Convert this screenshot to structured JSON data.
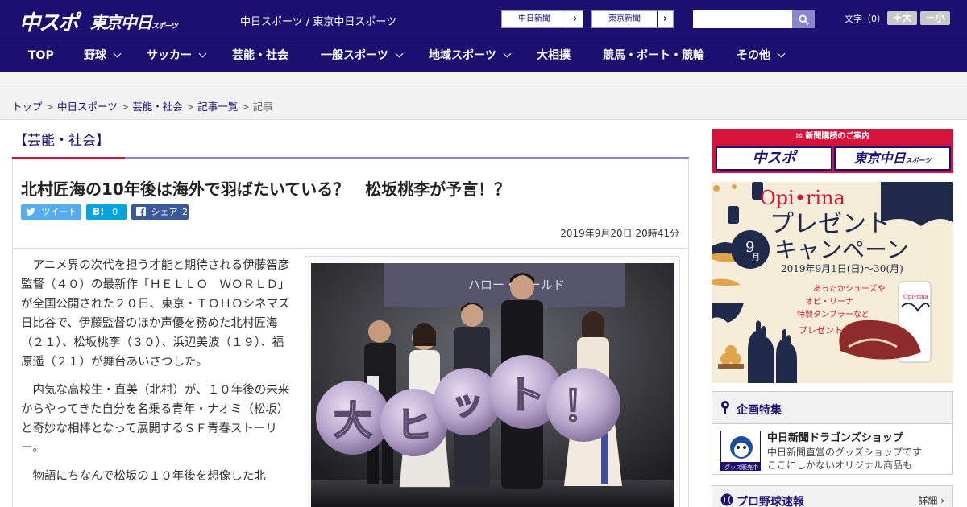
{
  "header": {
    "logo_chuspo": "中スポ",
    "logo_tokyo": "東京中日",
    "logo_tokyo_sub": "スポーツ",
    "site_title": "中日スポーツ / 東京中日スポーツ",
    "btn_chunichi": "中日新聞",
    "btn_tokyo": "東京新聞",
    "arrow": "›",
    "font_size_label": "文字（0）",
    "font_up": "＋大",
    "font_down": "－小"
  },
  "nav": {
    "items": [
      {
        "label": "TOP",
        "has_menu": false
      },
      {
        "label": "野球",
        "has_menu": true
      },
      {
        "label": "サッカー",
        "has_menu": true
      },
      {
        "label": "芸能・社会",
        "has_menu": false
      },
      {
        "label": "一般スポーツ",
        "has_menu": true
      },
      {
        "label": "地域スポーツ",
        "has_menu": true
      },
      {
        "label": "大相撲",
        "has_menu": false
      },
      {
        "label": "競馬・ボート・競輪",
        "has_menu": false
      },
      {
        "label": "その他",
        "has_menu": true
      }
    ]
  },
  "breadcrumb": {
    "items": [
      "トップ",
      "中日スポーツ",
      "芸能・社会",
      "記事一覧"
    ],
    "current": "記事",
    "separator": ">"
  },
  "article": {
    "category": "【芸能・社会】",
    "headline": "北村匠海の10年後は海外で羽ばたいている？　松坂桃李が予言！？",
    "share": {
      "tweet": "ツイート",
      "hatena_logo": "B!",
      "hatena_count": "0",
      "facebook": "シェア",
      "facebook_count": "2"
    },
    "date": "2019年9月20日 20時41分",
    "paragraphs": [
      "アニメ界の次代を担う才能と期待される伊藤智彦監督（４０）の最新作「ＨＥＬＬＯ　ＷＯＲＬＤ」が全国公開された２０日、東京・ＴＯＨＯシネマズ日比谷で、伊藤監督のほか声優を務めた北村匠海（２１）、松坂桃李（３０）、浜辺美波（１９）、福原遥（２１）が舞台あいさつした。",
      "内気な高校生・直美（北村）が、１０年後の未来からやってきた自分を名乗る青年・ナオミ（松坂）と奇妙な相棒となって展開するＳＦ青春ストーリー。",
      "物語にちなんで松坂の１０年後を想像した北"
    ],
    "photo_text": {
      "screen_text": "ハロー・ワールド",
      "banner_text": [
        "大",
        "ヒ",
        "ッ",
        "ト",
        "！"
      ]
    }
  },
  "sidebar": {
    "subscription": {
      "title": "新聞購読のご案内",
      "chuspo": "中スポ",
      "tokyo": "東京中日",
      "tokyo_sub": "スポーツ"
    },
    "ad": {
      "brand": "Opi•rina",
      "title_line1": "プレゼント",
      "title_line2": "キャンペーン",
      "month": "9",
      "month_unit": "月",
      "period": "2019年9月1日(日)〜30(月)",
      "promo_line1": "あったかシューズや",
      "promo_line2": "オピ・リーナ",
      "promo_line3": "特製タンブラーなど",
      "promo_line4": "プレゼント!!",
      "tumbler_brand": "Opi•rina"
    },
    "feature": {
      "title": "企画特集",
      "shop_title": "中日新聞ドラゴンズショップ",
      "shop_desc1": "中日新聞直営のグッズショップです",
      "shop_desc2": "ここにしかないオリジナル商品も",
      "shop_badge": "グッズ販売中"
    },
    "baseball": {
      "title": "プロ野球速報",
      "detail": "詳細 ›"
    }
  },
  "colors": {
    "navy": "#1b1070",
    "accent_purple": "#8b85c9",
    "red": "#d4143a",
    "twitter": "#55acee",
    "hatena": "#00a4de",
    "facebook": "#3b5998"
  }
}
